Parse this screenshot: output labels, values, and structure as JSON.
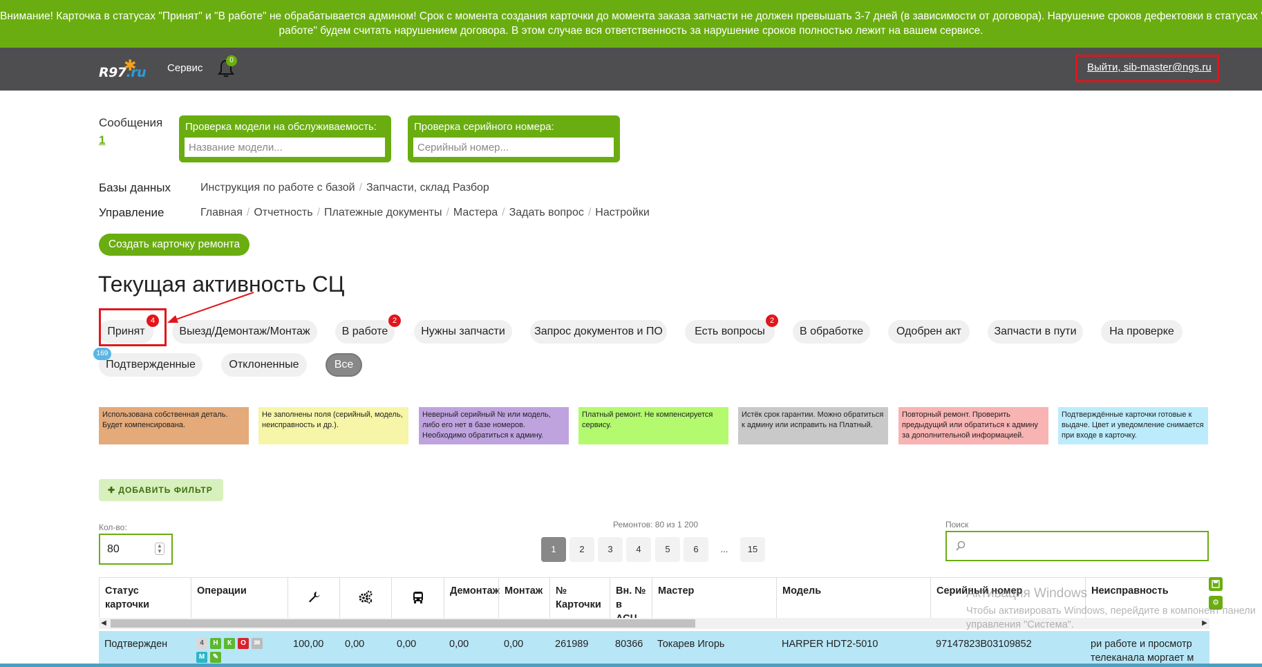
{
  "banner": {
    "line1": "Внимание! Карточка в статусах \"Принят\" и \"В работе\" не обрабатывается админом! Срок с момента создания карточки до момента заказа запчасти не должен превышать 3-7 дней (в зависимости от договора). Нарушение сроков дефектовки в статусах \"Принят\" и \"В",
    "line2": "работе\" будем считать нарушением договора. В этом случае вся ответственность за нарушение сроков полностью лежит на вашем сервисе."
  },
  "nav": {
    "logo": "R97",
    "logo_ru": ".ru",
    "service": "Сервис",
    "bell_count": "0",
    "logout": "Выйти, sib-master@ngs.ru"
  },
  "messages": {
    "label": "Сообщения",
    "count": "1"
  },
  "check_model": {
    "title": "Проверка модели на обслуживаемость:",
    "placeholder": "Название модели..."
  },
  "check_serial": {
    "title": "Проверка серийного номера:",
    "placeholder": "Серийный номер..."
  },
  "databases": {
    "label": "Базы данных",
    "links": [
      "Инструкция по работе с базой",
      "Запчасти, склад Разбор"
    ]
  },
  "management": {
    "label": "Управление",
    "links": [
      "Главная",
      "Отчетность",
      "Платежные документы",
      "Мастера",
      "Задать вопрос",
      "Настройки"
    ]
  },
  "create_button": "Создать карточку ремонта",
  "heading": "Текущая активность СЦ",
  "status_tabs": [
    {
      "label": "Принят",
      "badge": "4"
    },
    {
      "label": "Выезд/Демонтаж/Монтаж"
    },
    {
      "label": "В работе",
      "badge": "2"
    },
    {
      "label": "Нужны запчасти"
    },
    {
      "label": "Запрос документов и ПО"
    },
    {
      "label": "Есть вопросы",
      "badge": "2"
    },
    {
      "label": "В обработке"
    },
    {
      "label": "Одобрен акт"
    },
    {
      "label": "Запчасти в пути"
    },
    {
      "label": "На проверке"
    },
    {
      "label": "Подтвержденные",
      "badge": "169"
    },
    {
      "label": "Отклоненные"
    },
    {
      "label": "Все"
    }
  ],
  "legend": [
    {
      "text": "Использована собственная деталь. Будет компенсирована.",
      "color": "#e4aa7a"
    },
    {
      "text": "Не заполнены поля (серийный, модель, неисправность и др.).",
      "color": "#f6f5a8"
    },
    {
      "text": "Неверный серийный № или модель, либо его нет в базе номеров. Необходимо обратиться к админу.",
      "color": "#bfa3df"
    },
    {
      "text": "Платный ремонт. Не компенсируется сервису.",
      "color": "#b3fa6e"
    },
    {
      "text": "Истёк срок гарантии. Можно обратиться к админу или исправить на Платный.",
      "color": "#c9c9c9"
    },
    {
      "text": "Повторный ремонт. Проверить предыдущий или обратиться к админу за дополнительной информацией.",
      "color": "#f8b3b3"
    },
    {
      "text": "Подтверждённые карточки готовые к выдаче. Цвет и уведомление снимается при входе в карточку.",
      "color": "#bcecfb"
    }
  ],
  "add_filter": "ДОБАВИТЬ ФИЛЬТР",
  "quantity": {
    "label": "Кол-во:",
    "value": "80"
  },
  "repairs_count": "Ремонтов: 80 из 1 200",
  "pagination": [
    "1",
    "2",
    "3",
    "4",
    "5",
    "6",
    "...",
    "15"
  ],
  "search": {
    "label": "Поиск"
  },
  "table": {
    "headers": [
      "Статус карточки",
      "Операции",
      "",
      "",
      "",
      "Демонтаж",
      "Монтаж",
      "№ Карточки",
      "Вн. № в АСЦ",
      "Мастер",
      "Модель",
      "Серийный номер",
      "Неисправность"
    ],
    "header_icons": [
      "wrench-icon",
      "gears-icon",
      "bus-icon"
    ],
    "row": {
      "status": "Подтвержден",
      "ops": [
        "4",
        "Н",
        "К",
        "О",
        "М"
      ],
      "v1": "100,00",
      "v2": "0,00",
      "v3": "0,00",
      "dismantle": "0,00",
      "mount": "0,00",
      "card_no": "261989",
      "asc_no": "80366",
      "master": "Токарев Игорь",
      "model": "HARPER HDT2-5010",
      "serial": "97147823B03109852",
      "fault_l1": "ри работе и просмотр",
      "fault_l2": "телеканала моргает м"
    }
  },
  "watermark": {
    "title": "Активация Windows",
    "line1": "Чтобы активировать Windows, перейдите в компонент панели",
    "line2": "управления \"Система\"."
  }
}
